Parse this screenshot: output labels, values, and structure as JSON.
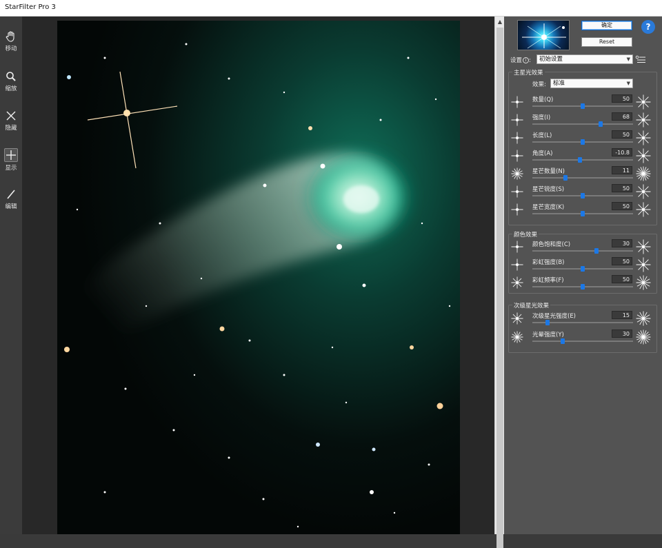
{
  "window": {
    "title": "StarFilter Pro 3"
  },
  "toolbar": {
    "tools": [
      {
        "id": "move",
        "label": "移动",
        "icon": "hand-icon"
      },
      {
        "id": "zoom",
        "label": "缩放",
        "icon": "magnifier-icon"
      },
      {
        "id": "hide",
        "label": "隐藏",
        "icon": "x-icon"
      },
      {
        "id": "show",
        "label": "显示",
        "icon": "plus-box-icon"
      },
      {
        "id": "edit",
        "label": "编辑",
        "icon": "pencil-icon"
      }
    ]
  },
  "panel": {
    "ok_label": "确定",
    "reset_label": "Reset",
    "help_label": "?",
    "preset_label": "设置",
    "preset_value": "初始设置",
    "main_group": {
      "title": "主星光效果",
      "effect_label": "效果:",
      "effect_value": "标准",
      "params": [
        {
          "label": "数量(Q)",
          "value": "50",
          "fraction": 0.5
        },
        {
          "label": "强度(I)",
          "value": "68",
          "fraction": 0.68
        },
        {
          "label": "长度(L)",
          "value": "50",
          "fraction": 0.5
        },
        {
          "label": "角度(A)",
          "value": "-10.8",
          "fraction": 0.47
        },
        {
          "label": "星芒数量(N)",
          "value": "11",
          "fraction": 0.33
        },
        {
          "label": "星芒锐度(S)",
          "value": "50",
          "fraction": 0.5
        },
        {
          "label": "星芒宽度(K)",
          "value": "50",
          "fraction": 0.5
        }
      ]
    },
    "color_group": {
      "title": "颜色效果",
      "params": [
        {
          "label": "颜色饱和度(C)",
          "value": "30",
          "fraction": 0.64
        },
        {
          "label": "彩虹强度(B)",
          "value": "50",
          "fraction": 0.5
        },
        {
          "label": "彩虹频率(F)",
          "value": "50",
          "fraction": 0.5
        }
      ]
    },
    "secondary_group": {
      "title": "次级星光效果",
      "params": [
        {
          "label": "次级星光强度(E)",
          "value": "15",
          "fraction": 0.15
        },
        {
          "label": "光晕强度(Y)",
          "value": "30",
          "fraction": 0.3
        }
      ]
    }
  },
  "colors": {
    "accent": "#1c78e6",
    "panel_bg": "#535353",
    "comet_core": "#2fd6b0"
  }
}
